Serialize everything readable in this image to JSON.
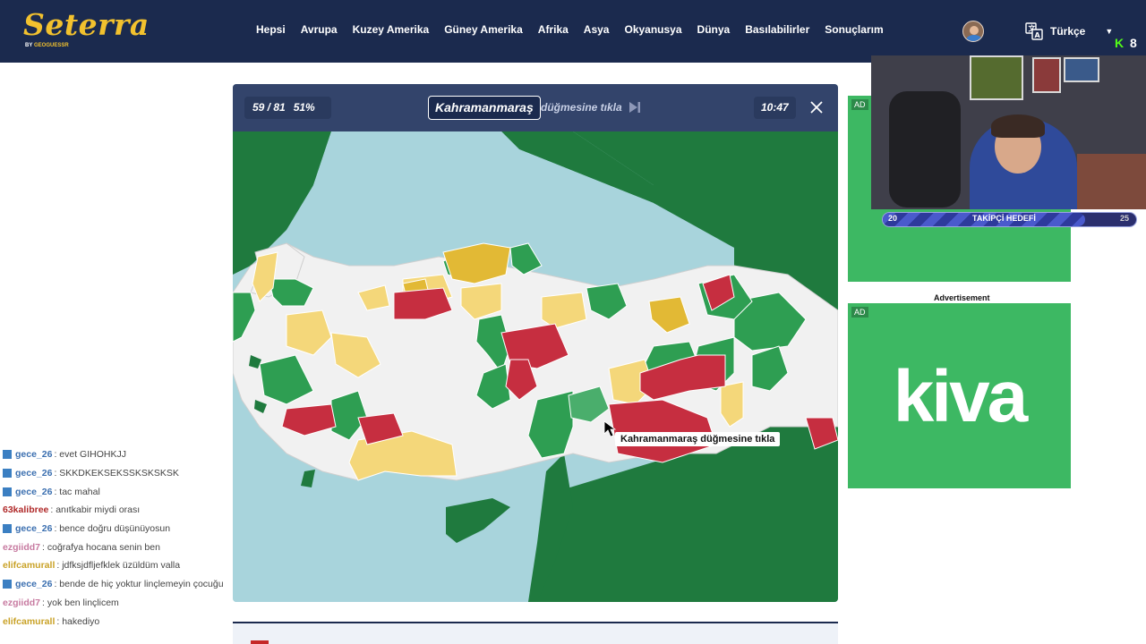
{
  "app": {
    "logo": "Seterra",
    "logo_by": "BY",
    "logo_brand": "GEOGUESSR"
  },
  "nav": {
    "items": [
      "Hepsi",
      "Avrupa",
      "Kuzey Amerika",
      "Güney Amerika",
      "Afrika",
      "Asya",
      "Okyanusya",
      "Dünya",
      "Basılabilirler",
      "Sonuçlarım"
    ],
    "language": "Türkçe"
  },
  "game": {
    "progress": "59 / 81",
    "percent": "51%",
    "target": "Kahramanmaraş",
    "prompt": "düğmesine tıkla",
    "timer": "10:47",
    "tooltip": "Kahramanmaraş düğmesine tıkla"
  },
  "ads": {
    "badge": "AD",
    "label": "Advertisement",
    "kiva_text": "kiva",
    "ad_color": "#3db863"
  },
  "stream": {
    "kick_logo": "K",
    "viewer_count": "8",
    "goal_current": "20",
    "goal_label": "TAKİPÇİ HEDEFİ",
    "goal_target": "25",
    "goal_progress": 0.8
  },
  "chat": {
    "messages": [
      {
        "user": "gece_26",
        "msg": ": evet GIHOHKJJ",
        "color": "#3b6fb0",
        "badge": true
      },
      {
        "user": "gece_26",
        "msg": ": SKKDKEKSEKSSKSKSKSK",
        "color": "#3b6fb0",
        "badge": true
      },
      {
        "user": "gece_26",
        "msg": ": tac mahal",
        "color": "#3b6fb0",
        "badge": true
      },
      {
        "user": "63kalibree",
        "msg": ": anıtkabir miydi orası",
        "color": "#b02a2a",
        "badge": false
      },
      {
        "user": "gece_26",
        "msg": ": bence doğru düşünüyosun",
        "color": "#3b6fb0",
        "badge": true
      },
      {
        "user": "ezgiidd7",
        "msg": ": coğrafya hocana senin ben",
        "color": "#c77aa0",
        "badge": false
      },
      {
        "user": "elifcamurall",
        "msg": ": jdfksjdfljefklek üzüldüm valla",
        "color": "#c9a227",
        "badge": false
      },
      {
        "user": "gece_26",
        "msg": ": bende de hiç yoktur linçlemeyin çocuğu",
        "color": "#3b6fb0",
        "badge": true
      },
      {
        "user": "ezgiidd7",
        "msg": ": yok ben linçlicem",
        "color": "#c77aa0",
        "badge": false
      },
      {
        "user": "elifcamurall",
        "msg": ": hakediyo",
        "color": "#c9a227",
        "badge": false
      }
    ]
  },
  "colors": {
    "nav_bg": "#1b2a4e",
    "header_bg": "#33446b",
    "sea": "#a8d4dc",
    "land_outside": "#1f7a3e",
    "correct_first": "#2e9e52",
    "correct_later": "#f4d77a",
    "wrong": "#c62e40",
    "unanswered": "#f1f1f1",
    "accent": "#f2c12e"
  }
}
